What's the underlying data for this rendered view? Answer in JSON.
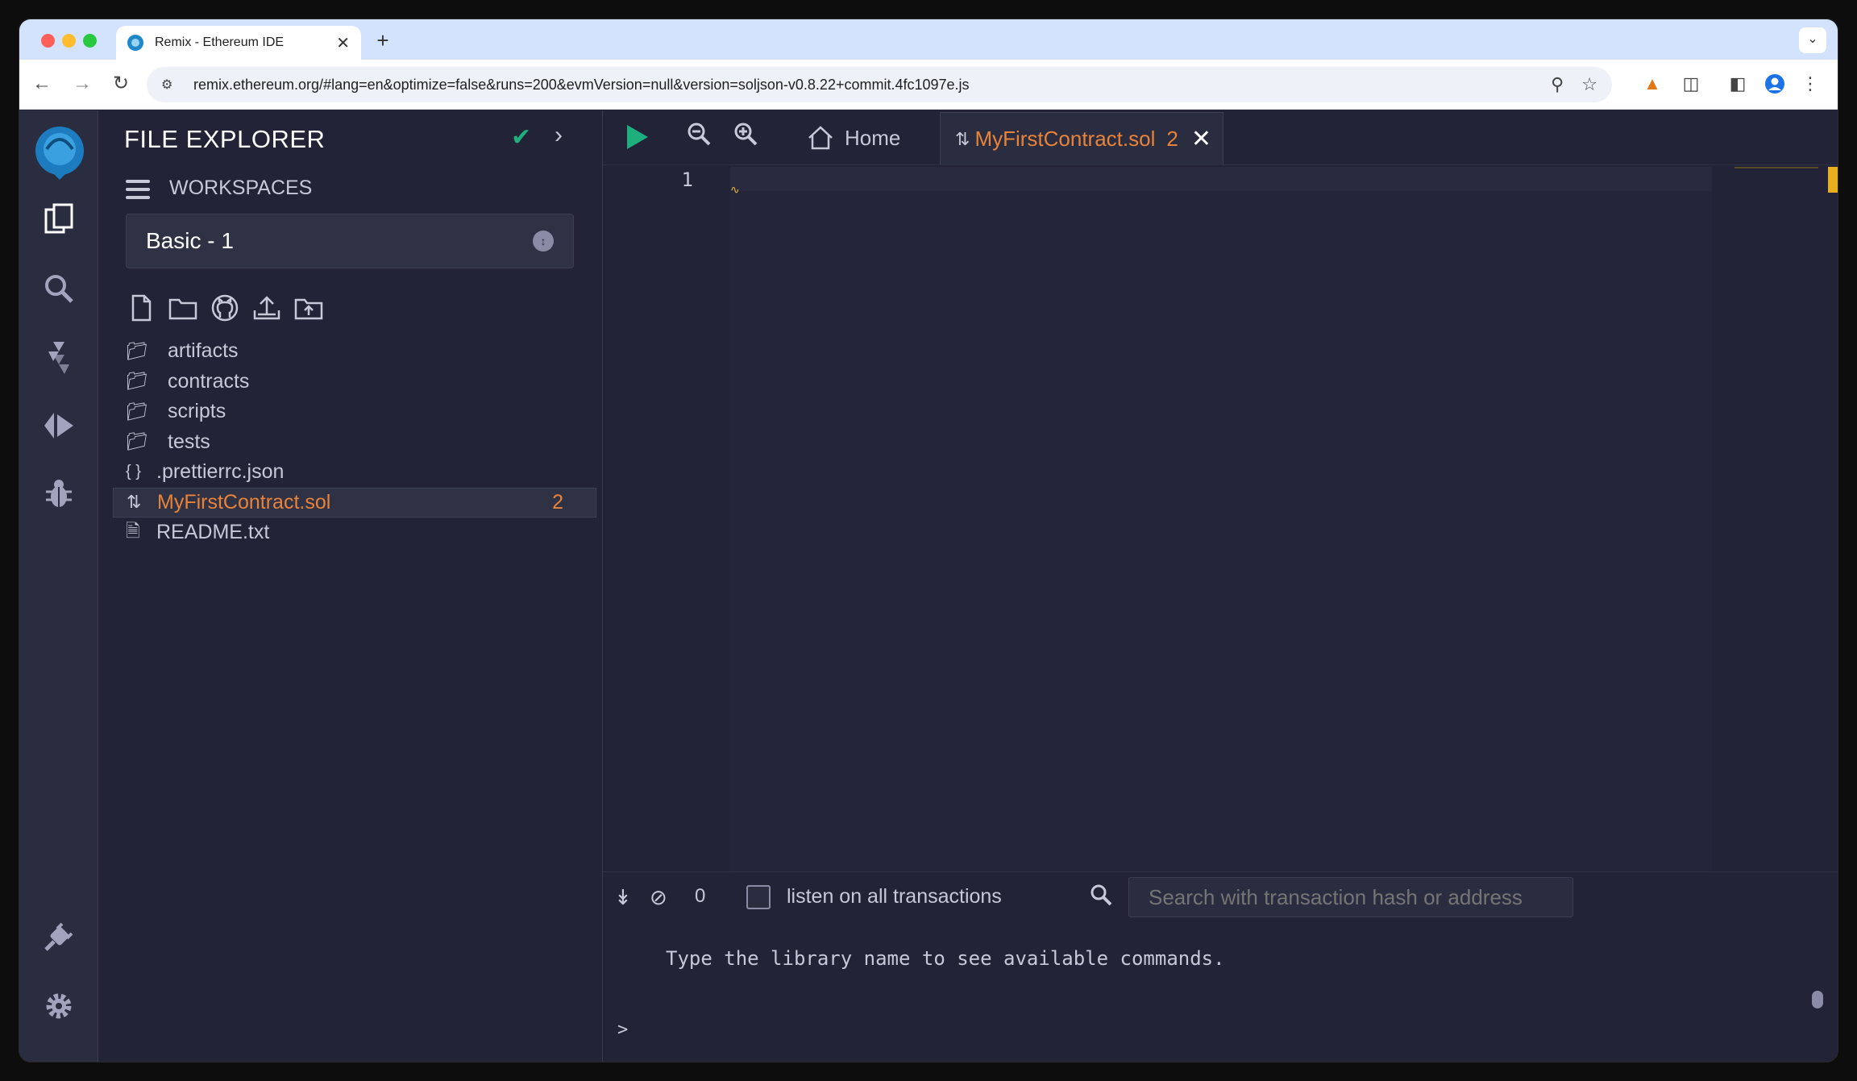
{
  "browser": {
    "tab_title": "Remix - Ethereum IDE",
    "tab_close": "✕",
    "new_tab": "+",
    "tab_menu": "⌄",
    "url": "remix.ethereum.org/#lang=en&optimize=false&runs=200&evmVersion=null&version=soljson-v0.8.22+commit.4fc1097e.js",
    "icons": [
      "back-icon",
      "forward-icon",
      "reload-icon",
      "site-settings-icon",
      "zoom-icon",
      "bookmark-star-icon",
      "metamask-icon",
      "extensions-icon",
      "side-panel-icon",
      "profile-icon",
      "more-menu-icon"
    ]
  },
  "iconbar": {
    "icons": [
      "remix-logo",
      "file-explorer-icon",
      "search-icon",
      "solidity-compiler-icon",
      "deploy-run-icon",
      "debugger-icon",
      "plugin-manager-icon",
      "settings-icon"
    ]
  },
  "side_panel": {
    "title": "FILE EXPLORER",
    "workspaces_label": "WORKSPACES",
    "workspace_selected": "Basic - 1",
    "tree": [
      {
        "type": "folder",
        "name": "artifacts"
      },
      {
        "type": "folder",
        "name": "contracts"
      },
      {
        "type": "folder",
        "name": "scripts"
      },
      {
        "type": "folder",
        "name": "tests"
      },
      {
        "type": "json",
        "name": ".prettierrc.json"
      },
      {
        "type": "sol",
        "name": "MyFirstContract.sol",
        "badge": "2",
        "selected": true
      },
      {
        "type": "txt",
        "name": "README.txt"
      }
    ]
  },
  "editor": {
    "home_tab": "Home",
    "file_tab": "MyFirstContract.sol",
    "file_tab_badge": "2",
    "line_number": "1",
    "colors": {
      "accent": "#e8833a",
      "run": "#1fae7d",
      "warning": "#e8b020"
    }
  },
  "terminal": {
    "count": "0",
    "listen_label": "listen on all transactions",
    "search_placeholder": "Search with transaction hash or address",
    "message": "Type the library name to see available commands.",
    "prompt": ">"
  }
}
